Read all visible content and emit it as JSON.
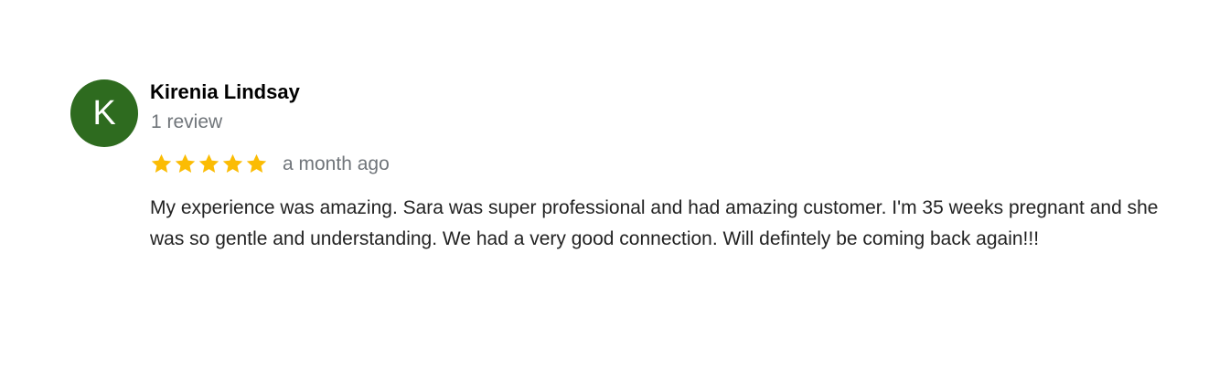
{
  "review": {
    "avatar_initial": "K",
    "reviewer_name": "Kirenia Lindsay",
    "review_count": "1 review",
    "rating": 5,
    "rating_max": 5,
    "star_color": "#fbbc04",
    "avatar_color": "#2e6b1f",
    "time_ago": "a month ago",
    "text": "My experience was amazing. Sara was super professional and had amazing customer. I'm 35 weeks pregnant and she was so gentle and understanding. We had a very good connection. Will defintely be coming back again!!!"
  }
}
